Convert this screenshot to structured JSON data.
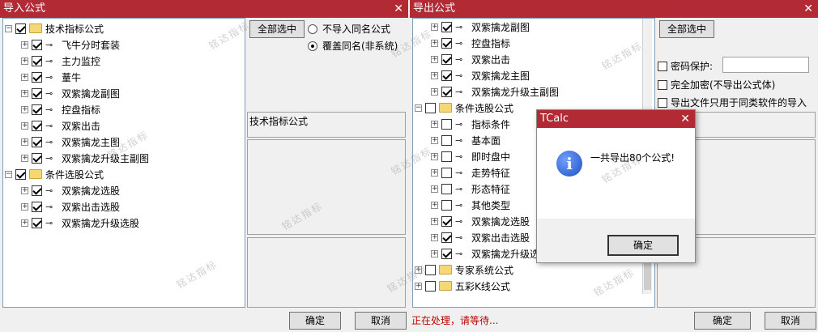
{
  "left": {
    "title": "导入公式",
    "close": "✕",
    "tree": [
      {
        "label": "技术指标公式",
        "type": "folder",
        "checked": true,
        "expanded": true
      },
      {
        "label": "飞牛分时套装",
        "type": "item",
        "checked": true
      },
      {
        "label": "主力监控",
        "type": "item",
        "checked": true
      },
      {
        "label": "蕫牛",
        "type": "item",
        "checked": true
      },
      {
        "label": "双紫擒龙副图",
        "type": "item",
        "checked": true
      },
      {
        "label": "控盘指标",
        "type": "item",
        "checked": true
      },
      {
        "label": "双紫出击",
        "type": "item",
        "checked": true
      },
      {
        "label": "双紫擒龙主图",
        "type": "item",
        "checked": true
      },
      {
        "label": "双紫擒龙升级主副图",
        "type": "item",
        "checked": true
      },
      {
        "label": "条件选股公式",
        "type": "folder",
        "checked": true,
        "expanded": true
      },
      {
        "label": "双紫擒龙选股",
        "type": "item",
        "checked": true
      },
      {
        "label": "双紫出击选股",
        "type": "item",
        "checked": true
      },
      {
        "label": "双紫擒龙升级选股",
        "type": "item",
        "checked": true
      }
    ],
    "select_all": "全部选中",
    "radio_skip": "不导入同名公式",
    "radio_overwrite": "覆盖同名(非系统)",
    "radio_overwrite_selected": true,
    "info_panel_title": "技术指标公式",
    "ok": "确定",
    "cancel": "取消"
  },
  "right": {
    "title": "导出公式",
    "close": "✕",
    "tree": [
      {
        "label": "双紫擒龙副图",
        "type": "item",
        "checked": true
      },
      {
        "label": "控盘指标",
        "type": "item",
        "checked": true
      },
      {
        "label": "双紫出击",
        "type": "item",
        "checked": true
      },
      {
        "label": "双紫擒龙主图",
        "type": "item",
        "checked": true
      },
      {
        "label": "双紫擒龙升级主副图",
        "type": "item",
        "checked": true
      },
      {
        "label": "条件选股公式",
        "type": "folder",
        "checked": false,
        "expanded": true
      },
      {
        "label": "指标条件",
        "type": "item",
        "checked": false
      },
      {
        "label": "基本面",
        "type": "item",
        "checked": false
      },
      {
        "label": "即时盘中",
        "type": "item",
        "checked": false
      },
      {
        "label": "走势特征",
        "type": "item",
        "checked": false
      },
      {
        "label": "形态特征",
        "type": "item",
        "checked": false
      },
      {
        "label": "其他类型",
        "type": "item",
        "checked": false
      },
      {
        "label": "双紫擒龙选股",
        "type": "item",
        "checked": true
      },
      {
        "label": "双紫出击选股",
        "type": "item",
        "checked": true
      },
      {
        "label": "双紫擒龙升级选",
        "type": "item",
        "checked": true
      },
      {
        "label": "专家系统公式",
        "type": "folder",
        "checked": false,
        "expanded": false
      },
      {
        "label": "五彩K线公式",
        "type": "folder",
        "checked": false,
        "expanded": false
      }
    ],
    "select_all": "全部选中",
    "password_label": "密码保护:",
    "full_encrypt_label": "完全加密(不导出公式体)",
    "same_software_label": "导出文件只用于同类软件的导入",
    "ok": "确定",
    "cancel": "取消",
    "status": "正在处理，请等待..."
  },
  "dialog": {
    "title": "TCalc",
    "close": "✕",
    "message": "一共导出80个公式!",
    "ok": "确定",
    "icon_glyph": "i"
  },
  "watermark": "铭达指标",
  "colors": {
    "titlebar": "#b12a34",
    "status": "#c00000"
  }
}
